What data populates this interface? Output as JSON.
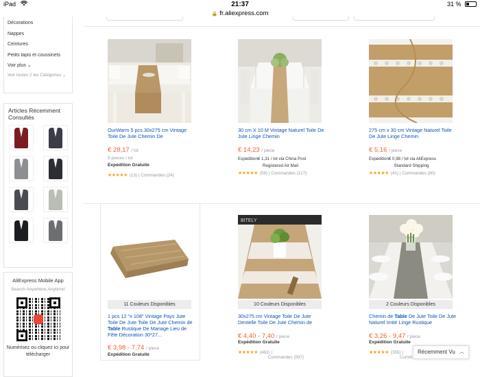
{
  "status": {
    "device": "iPad",
    "time": "21:37",
    "battery": "31 %"
  },
  "url": "fr.aliexpress.com",
  "sidebar": {
    "categories": [
      "Décorations",
      "Nappes",
      "Ceintures",
      "Petits tapis et coussinets"
    ],
    "voir_plus": "Voir plus",
    "voir_toutes": "Voir toutes 2 les Catégories",
    "recent_title": "Articles Récemment Consultés",
    "mobile_title": "AliExpress Mobile App",
    "mobile_search": "Search Anywhere,Anytime!",
    "mobile_scan": "Numérisez ou cliquez ici pour télécharger"
  },
  "products": [
    {
      "title": "OurWarm 5 pcs 30x275 cm Vintage Toile De Jute Chemin De",
      "price": "€ 28,17",
      "unit": "/ lot",
      "sub": "5 pieces / lot",
      "shipping": "Expédition Gratuite",
      "rating_count": "(13)",
      "orders": "Commandes (24)"
    },
    {
      "title": "30 cm X 10 M Vintage Naturel Toile De Jute Linge Chemin",
      "price": "€ 14,23",
      "unit": "/ piece",
      "ship_line1": "Expédition€ 1,31 / lot via China Post",
      "ship_line2": "Registered Air Mail",
      "rating_count": "(58)",
      "orders": "Commandes (127)"
    },
    {
      "title": "275 cm x 30 cm Vintage Naturel Toile De Jute Linge Chemin",
      "price": "€ 5,16",
      "unit": "/ piece",
      "ship_line1": "Expédition€ 0,98 / lot via AliExpress",
      "ship_line2": "Standard Shipping",
      "rating_count": "(41)",
      "orders": "Commandes (80)"
    },
    {
      "colors": "11 Couleurs Disponibles",
      "title_a": "1 pcs 12 \"x 108\" Vintage Pays Jute Toile De Jute Toile De Jute Chemin de ",
      "title_bold": "Table",
      "title_b": " Rustique De Mariage Lieu de Fête Décoration 30*27...",
      "price": "€ 3,98 - 7,74",
      "unit": "/ piece",
      "shipping": "Expédition Gratuite"
    },
    {
      "colors": "10 Couleurs Disponibles",
      "title": "30x275 cm Vintage Toile De Jute Dentelle Toile De Jute Chemin de",
      "price": "€ 4,40 - 7,40",
      "unit": "/ piece",
      "shipping": "Expédition Gratuite",
      "rating_count": "(462)",
      "orders": "Commandes (597)"
    },
    {
      "colors": "2 Couleurs Disponibles",
      "title_a": "Chemin de ",
      "title_bold": "Table",
      "title_b": " De Jute Toile De Jute Naturel Imité Linge Rustique",
      "price": "€ 3,26 - 9,47",
      "unit": "/ piece",
      "shipping": "Expédition Gratuite",
      "rating_count": "(355)",
      "orders": "Commandes (1"
    }
  ],
  "recently_viewed": "Récemment Vu",
  "colors": {
    "link": "#0a54b6",
    "price": "#f06233",
    "star": "#f8a31b"
  }
}
